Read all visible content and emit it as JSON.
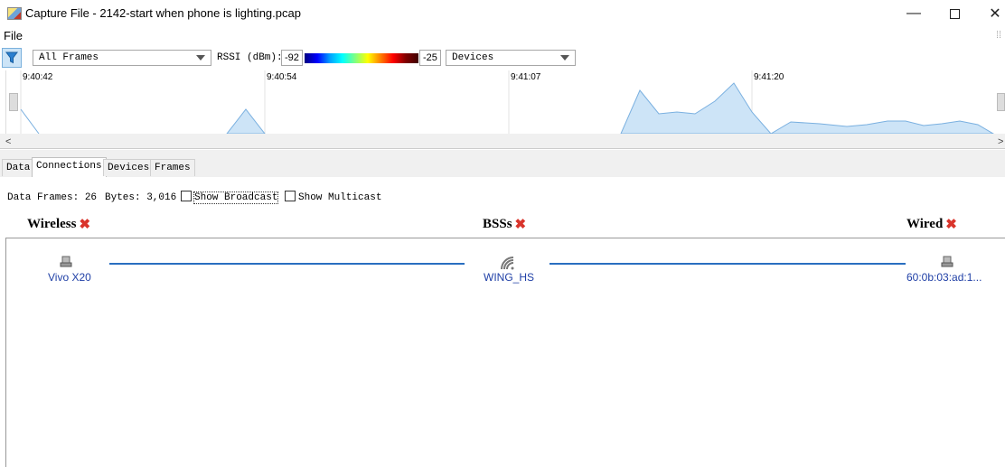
{
  "window": {
    "title": "Capture File - 2142-start when phone is lighting.pcap",
    "minimize": "—",
    "close": "✕"
  },
  "menu": {
    "file": "File"
  },
  "toolbar": {
    "frames_filter": "All Frames",
    "rssi_label": "RSSI (dBm):",
    "rssi_min": "-92",
    "rssi_max": "-25",
    "view_select": "Devices"
  },
  "timeline": {
    "ticks": [
      "9:40:42",
      "9:40:54",
      "9:41:07",
      "9:41:20"
    ],
    "fill_color": "#cde4f7",
    "line_color": "#7ab0e0"
  },
  "tabs": [
    {
      "label": "Data",
      "active": false
    },
    {
      "label": "Connections",
      "active": true
    },
    {
      "label": "Devices",
      "active": false
    },
    {
      "label": "Frames",
      "active": false
    }
  ],
  "stats": {
    "data_frames": "Data Frames: 26",
    "bytes": "Bytes: 3,016",
    "show_broadcast": "Show Broadcast",
    "show_multicast": "Show Multicast"
  },
  "columns": {
    "wireless": "Wireless",
    "bsss": "BSSs",
    "wired": "Wired"
  },
  "nodes": {
    "wireless": "Vivo X20",
    "bss": "WING_HS",
    "wired": "60:0b:03:ad:1..."
  },
  "colors": {
    "link": "#2a6fc0",
    "node_text": "#1f3fa6",
    "remove": "#d9342b"
  }
}
